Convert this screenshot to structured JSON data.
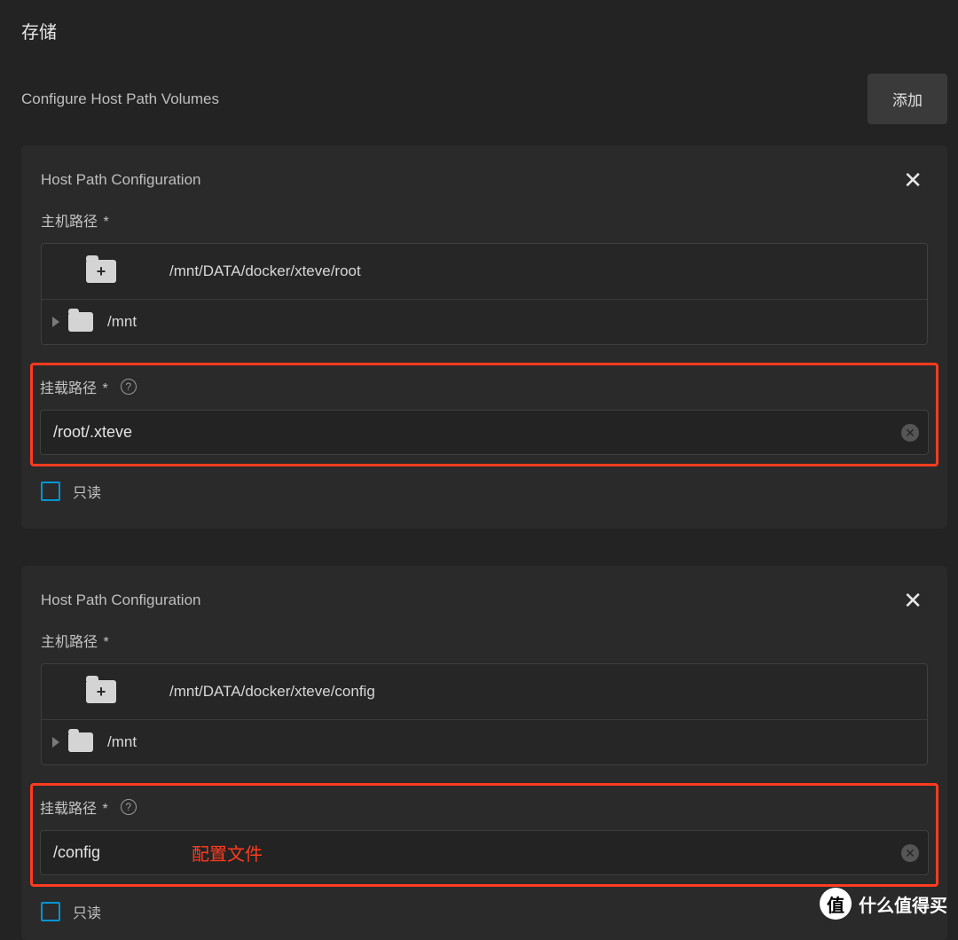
{
  "page": {
    "title": "存储",
    "subtitle": "Configure Host Path Volumes",
    "add_button": "添加"
  },
  "labels": {
    "host_path": "主机路径",
    "mount_path": "挂载路径",
    "required": "*",
    "readonly": "只读",
    "mnt": "/mnt"
  },
  "volumes": [
    {
      "section_title": "Host Path Configuration",
      "host_path": "/mnt/DATA/docker/xteve/root",
      "mount_path": "/root/.xteve",
      "readonly": false,
      "annotation": ""
    },
    {
      "section_title": "Host Path Configuration",
      "host_path": "/mnt/DATA/docker/xteve/config",
      "mount_path": "/config",
      "readonly": false,
      "annotation": "配置文件"
    }
  ],
  "watermark": {
    "badge": "值",
    "text": "什么值得买"
  }
}
